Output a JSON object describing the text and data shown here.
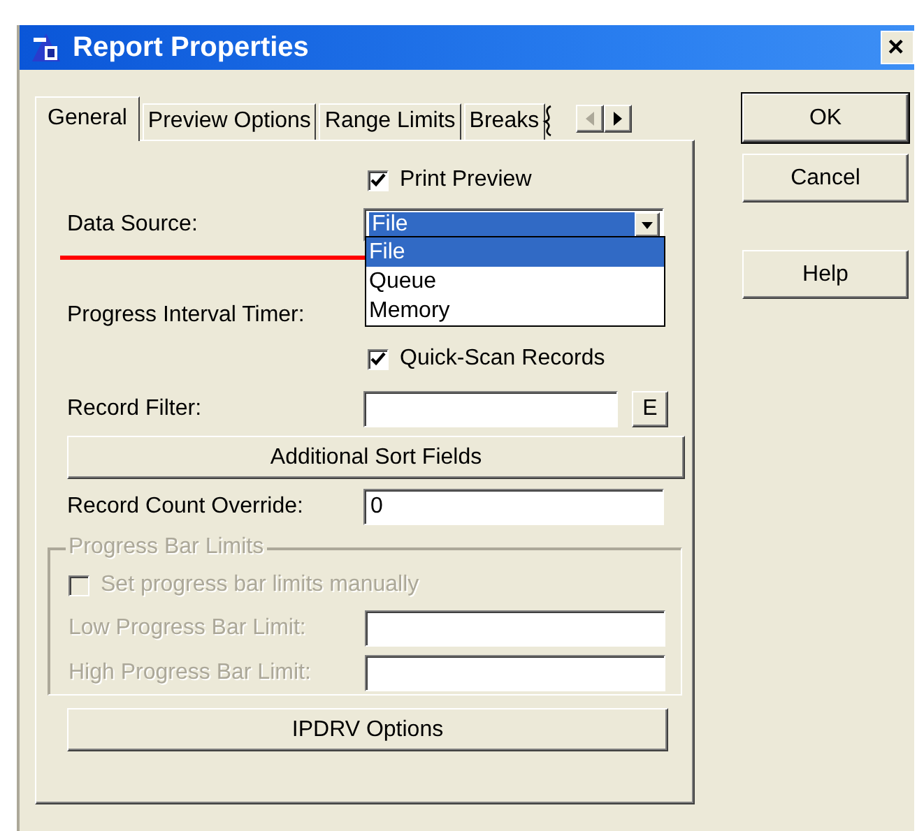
{
  "window": {
    "title": "Report Properties",
    "close": "×"
  },
  "tabs": [
    {
      "label": "General",
      "selected": true
    },
    {
      "label": "Preview Options",
      "selected": false
    },
    {
      "label": "Range Limits",
      "selected": false
    },
    {
      "label": "Breaks",
      "selected": false
    }
  ],
  "tab_scroll": [
    {
      "kind": "left",
      "disabled": true
    },
    {
      "kind": "right",
      "disabled": false
    }
  ],
  "print_preview": {
    "label": "Print Preview",
    "checked": true
  },
  "data_source": {
    "label": "Data Source:",
    "value": "File",
    "expanded": true,
    "options": [
      {
        "label": "File",
        "selected": true
      },
      {
        "label": "Queue",
        "selected": false
      },
      {
        "label": "Memory",
        "selected": false
      }
    ]
  },
  "annotation": {
    "kind": "line",
    "color": "#ff0000"
  },
  "progress_interval_timer": {
    "label": "Progress Interval Timer:"
  },
  "quick_scan": {
    "label": "Quick-Scan Records",
    "checked": true
  },
  "record_filter": {
    "label": "Record Filter:",
    "button": "E"
  },
  "sort_button": "Additional Sort Fields",
  "record_count_override": {
    "label": "Record Count Override:",
    "value": "0"
  },
  "progress_bar_limits": {
    "legend": "Progress Bar Limits",
    "disabled": true,
    "checkbox": {
      "label": "Set progress bar limits manually",
      "checked": false
    },
    "low": {
      "label": "Low Progress Bar Limit:"
    },
    "high": {
      "label": "High Progress Bar Limit:"
    }
  },
  "ipdrv_button": "IPDRV Options",
  "buttons": [
    {
      "label": "OK",
      "default": true
    },
    {
      "label": "Cancel",
      "default": false
    },
    {
      "label": "Help",
      "default": false
    }
  ]
}
